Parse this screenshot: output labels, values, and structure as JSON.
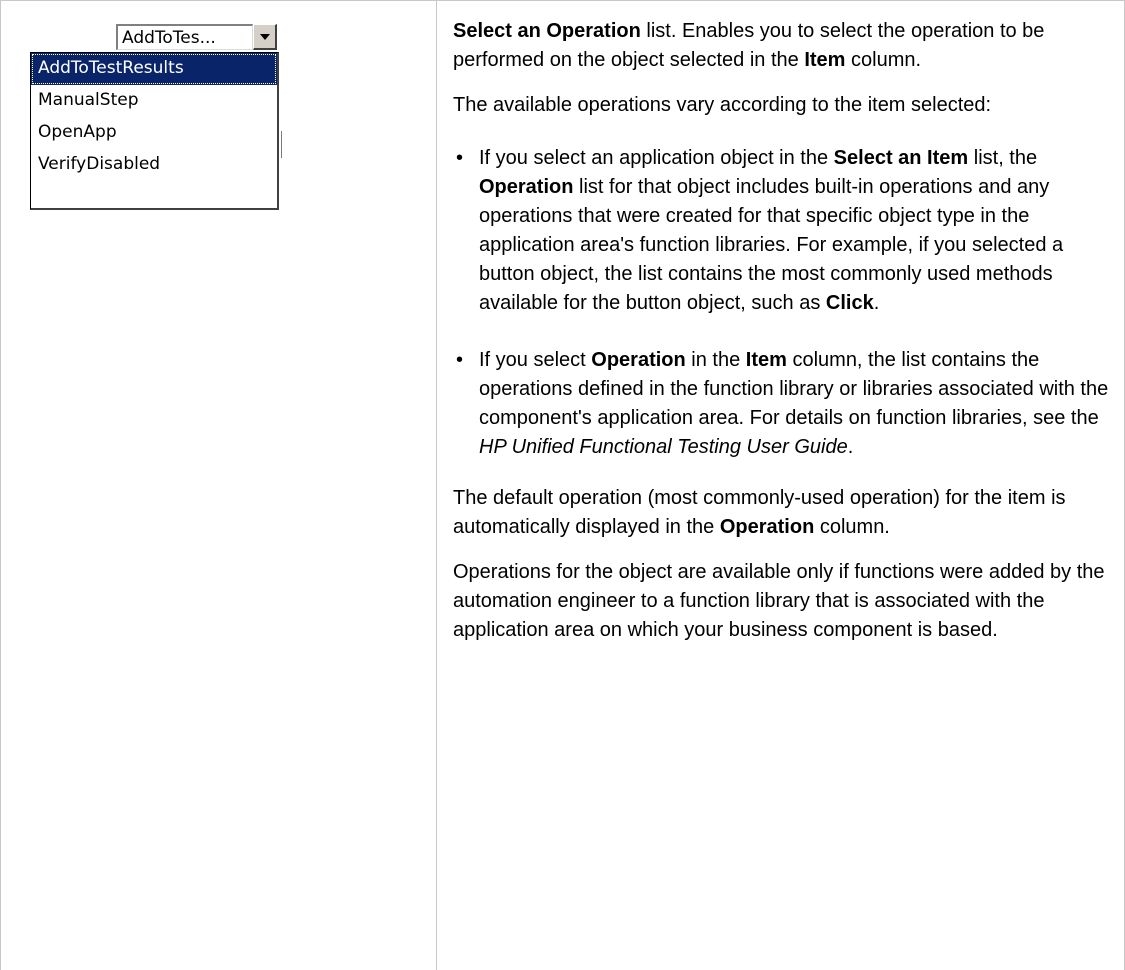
{
  "combo": {
    "value": "AddToTes...",
    "options": [
      "AddToTestResults",
      "ManualStep",
      "OpenApp",
      "VerifyDisabled"
    ],
    "selected": "AddToTestResults",
    "button_icon": "triangle-down-icon"
  },
  "description": {
    "p1": {
      "b1": "Select an Operation",
      "t1": " list. Enables you to select the operation to be performed on the object selected in the ",
      "b2": "Item",
      "t2": " column."
    },
    "p2": "The available operations vary according to the item selected:",
    "bullets": [
      {
        "t1": "If you select an application object in the ",
        "b1": "Select an Item",
        "t2": " list, the ",
        "b2": "Operation",
        "t3": " list for that object includes built-in operations and any operations that were created for that specific object type in the application area's function libraries. For example, if you selected a button object, the list contains the most commonly used methods available for the button object, such as ",
        "b3": "Click",
        "t4": "."
      },
      {
        "t1": "If you select ",
        "b1": "Operation",
        "t2": " in the ",
        "b2": "Item",
        "t3": " column, the list contains the operations defined in the function library or libraries associated with the component's application area. For details on function libraries, see the ",
        "i1": "HP Unified Functional Testing User Guide",
        "t4": "."
      }
    ],
    "p3": {
      "t1": "The default operation (most commonly-used operation) for the item is automatically displayed in the ",
      "b1": "Operation",
      "t2": " column."
    },
    "p4": "Operations for the object are available only if functions were added by the automation engineer to a function library that is associated with the application area on which your business component is based.",
    "bullet_glyph": "•"
  }
}
